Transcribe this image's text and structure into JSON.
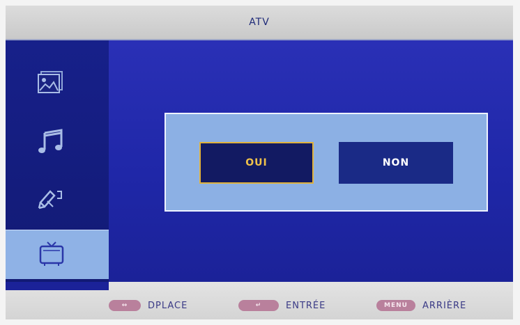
{
  "header": {
    "title": "ATV"
  },
  "sidebar": {
    "items": [
      {
        "icon": "photo-icon"
      },
      {
        "icon": "music-note-icon"
      },
      {
        "icon": "edit-pen-icon"
      },
      {
        "icon": "tv-icon",
        "active": true
      }
    ]
  },
  "dialog": {
    "yes_label": "OUI",
    "no_label": "NON"
  },
  "footer": {
    "move_key": "↔",
    "move_label": "DPLACE",
    "enter_key": "↵",
    "enter_label": "ENTRÉE",
    "menu_key": "MENU",
    "menu_label": "ARRIÈRE"
  },
  "colors": {
    "main_bg": "#2a30b6",
    "sidebar_bg": "#17208a",
    "dialog_bg": "#8cb0e4",
    "yes_text": "#f0c24a",
    "key_badge": "#b9809c"
  }
}
